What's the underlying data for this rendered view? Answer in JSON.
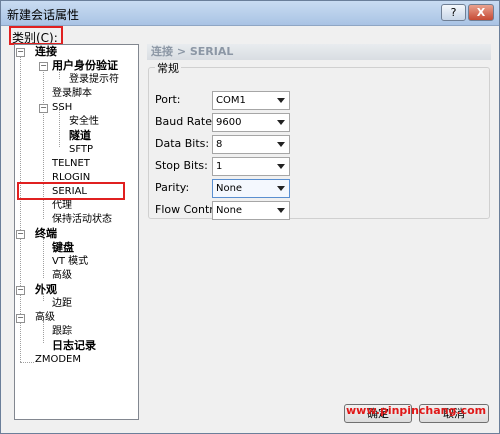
{
  "window": {
    "title": "新建会话属性",
    "help_label": "?",
    "close_label": "X"
  },
  "category": {
    "label": "类别(C):"
  },
  "tree": {
    "n1": "连接",
    "n2": "用户身份验证",
    "n3": "登录提示符",
    "n4": "登录脚本",
    "n5": "SSH",
    "n6": "安全性",
    "n7": "隧道",
    "n8": "SFTP",
    "n9": "TELNET",
    "n10": "RLOGIN",
    "n11": "SERIAL",
    "n12": "代理",
    "n13": "保持活动状态",
    "n14": "终端",
    "n15": "键盘",
    "n16": "VT 模式",
    "n17": "高级",
    "n18": "外观",
    "n19": "边距",
    "n20": "高级",
    "n21": "跟踪",
    "n22": "日志记录",
    "n23": "ZMODEM"
  },
  "panel": {
    "breadcrumb": "连接 > SERIAL",
    "group_title": "常规",
    "fields": {
      "port": {
        "label": "Port:",
        "value": "COM1"
      },
      "baud_rate": {
        "label": "Baud Rate:",
        "value": "9600"
      },
      "data_bits": {
        "label": "Data Bits:",
        "value": "8"
      },
      "stop_bits": {
        "label": "Stop Bits:",
        "value": "1"
      },
      "parity": {
        "label": "Parity:",
        "value": "None"
      },
      "flow_control": {
        "label": "Flow Control:",
        "value": "None"
      }
    }
  },
  "buttons": {
    "ok": "确定",
    "cancel": "取消"
  },
  "watermark": "www.pinpinchang.com",
  "colors": {
    "highlight_box": "#e02020"
  }
}
